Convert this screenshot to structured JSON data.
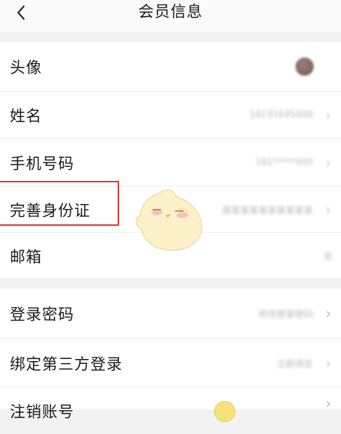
{
  "header": {
    "title": "会员信息"
  },
  "rows": [
    {
      "label": "头像"
    },
    {
      "label": "姓名",
      "value": "18131645400"
    },
    {
      "label": "手机号码",
      "value": "181*****400"
    },
    {
      "label": "完善身份证",
      "value": "周某某某某某某某某某"
    },
    {
      "label": "邮箱",
      "value": "无"
    }
  ],
  "rows2": [
    {
      "label": "登录密码",
      "value": "修改登录密码"
    },
    {
      "label": "绑定第三方登录",
      "value": "立即绑定"
    },
    {
      "label": "注销账号"
    }
  ],
  "icons": {
    "back": "chevron-left-icon",
    "row_arrow": "chevron-right-icon",
    "sticker": "chick-sticker",
    "bottom_emoji": "emoji-face"
  },
  "colors": {
    "highlight": "#e4312b",
    "background": "#f2f2f2",
    "card": "#ffffff",
    "text": "#1b1b1b",
    "secondary": "#b8b8b8"
  }
}
